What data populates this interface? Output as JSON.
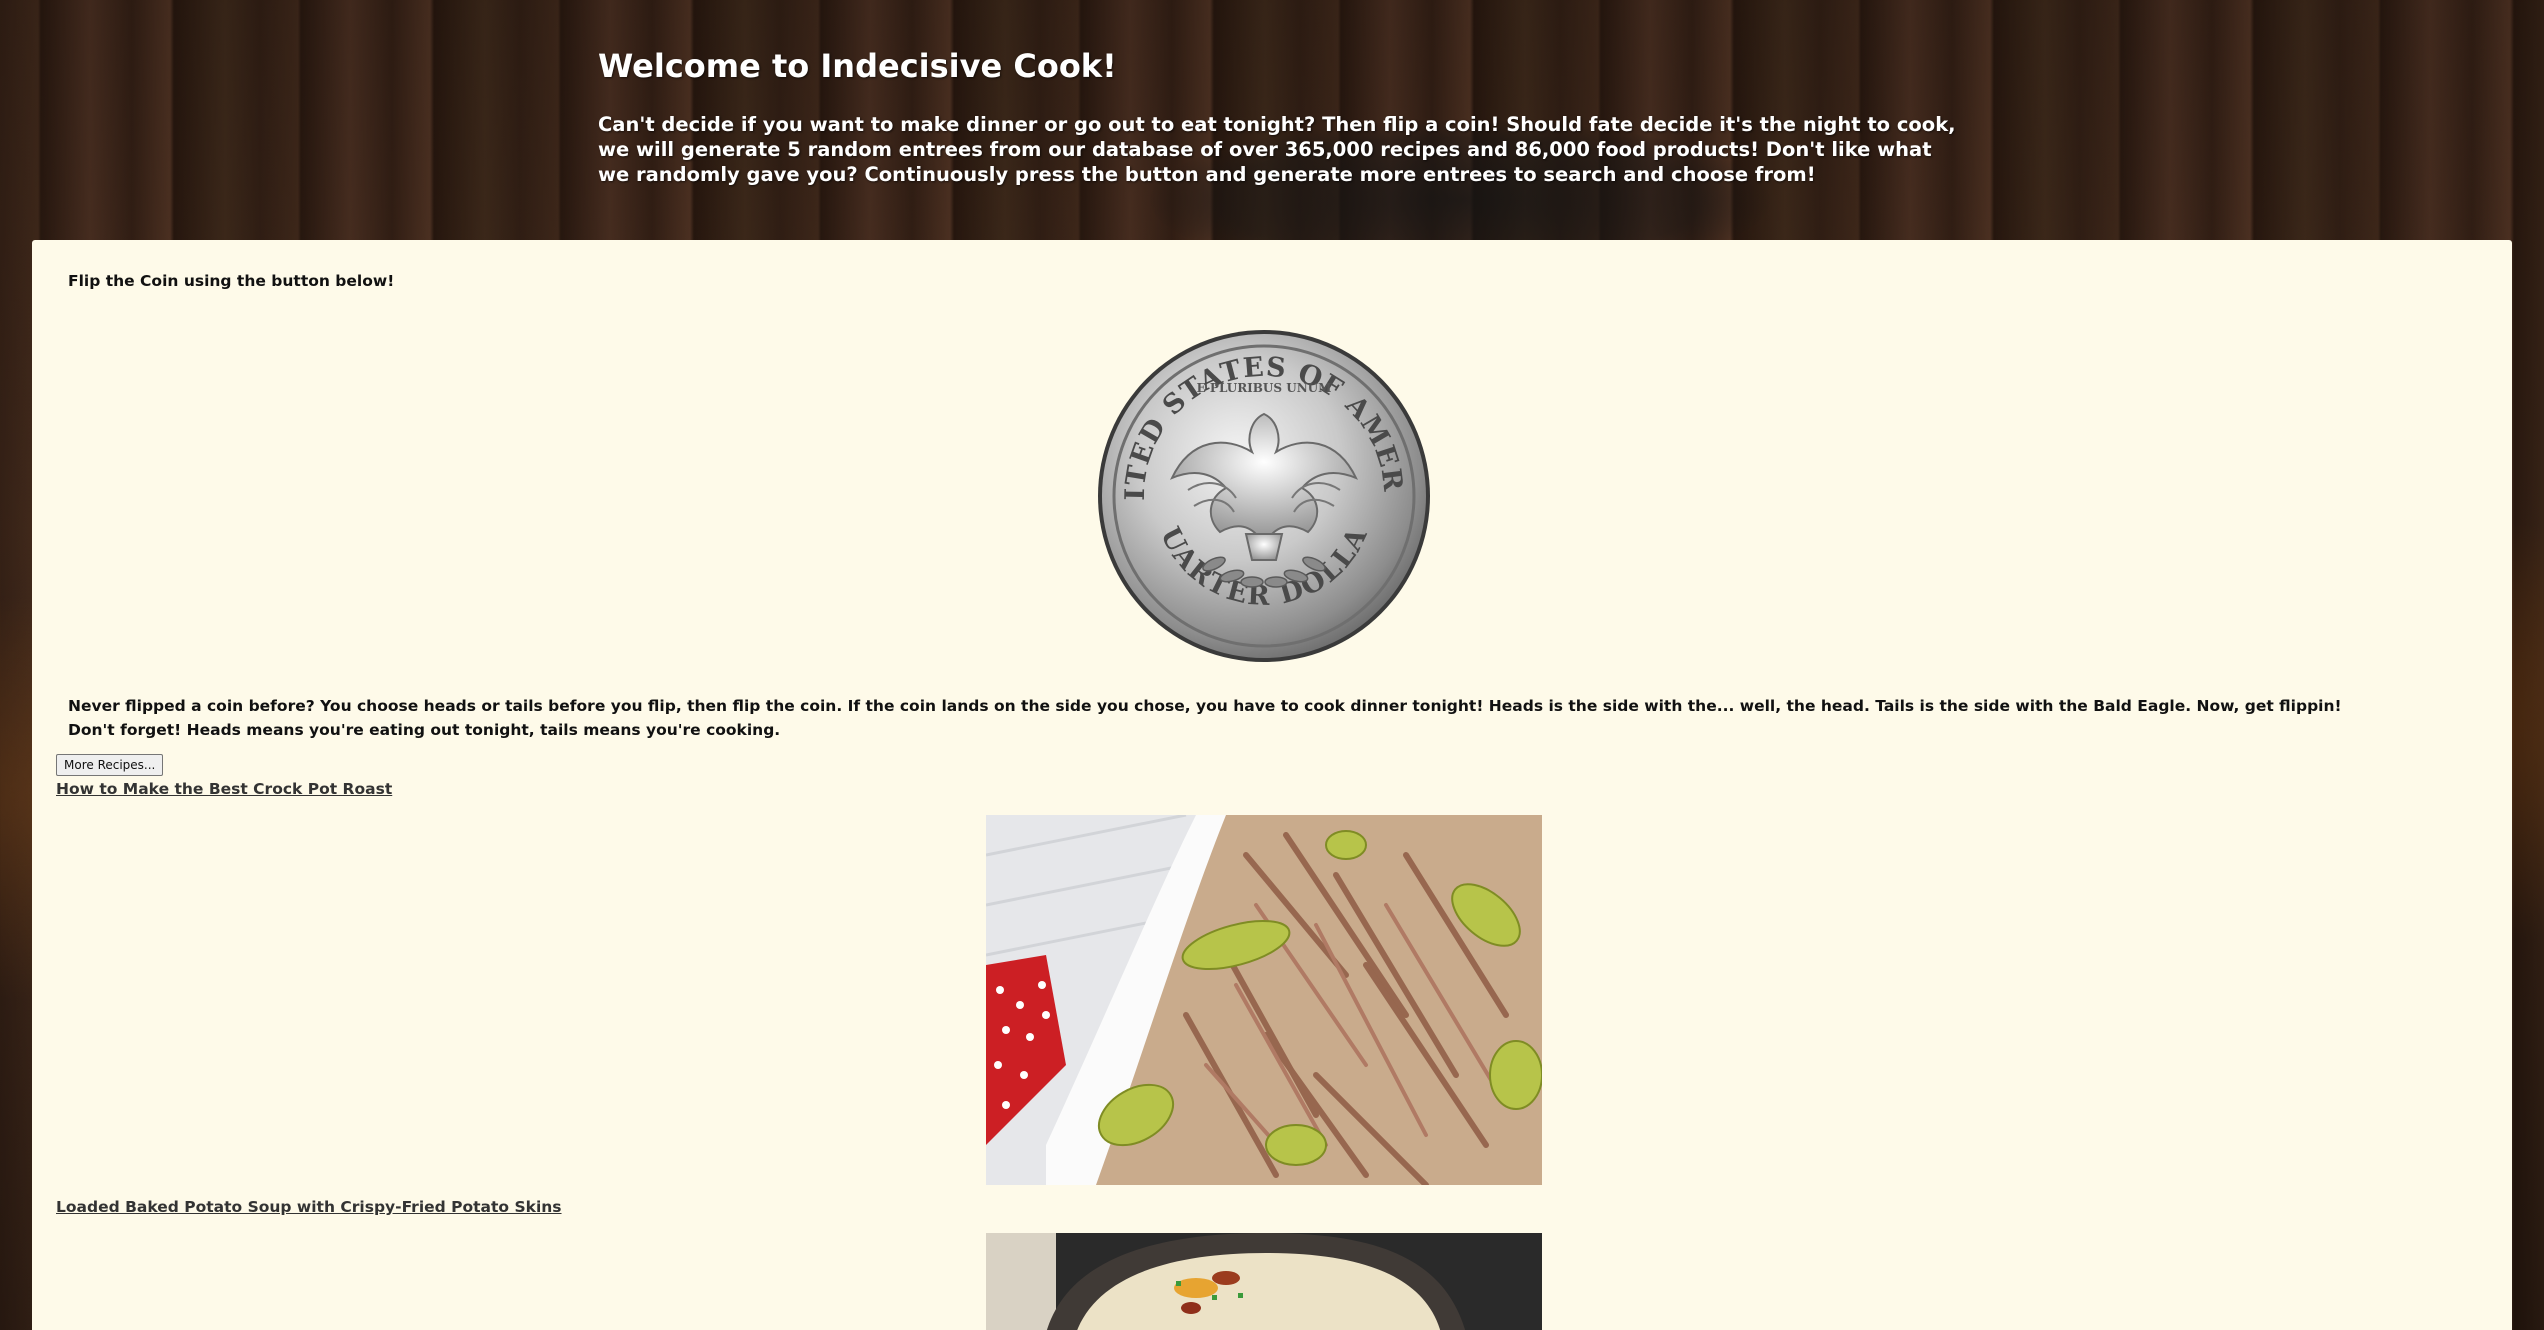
{
  "header": {
    "title": "Welcome to Indecisive Cook!",
    "intro": "Can't decide if you want to make dinner or go out to eat tonight? Then flip a coin! Should fate decide it's the night to cook, we will generate 5 random entrees from our database of over 365,000 recipes and 86,000 food products! Don't like what we randomly gave you? Continuously press the button and generate more entrees to search and choose from!"
  },
  "coin_section": {
    "instruction": "Flip the Coin using the button below!",
    "coin_top_text": "UNITED STATES OF AMERICA",
    "coin_motto": "E PLURIBUS UNUM",
    "coin_bottom_text": "QUARTER DOLLAR",
    "help_text": "Never flipped a coin before? You choose heads or tails before you flip, then flip the coin. If the coin lands on the side you chose, you have to cook dinner tonight! Heads is the side with the... well, the head. Tails is the side with the Bald Eagle. Now, get flippin! Don't forget! Heads means you're eating out tonight, tails means you're cooking."
  },
  "recipes": {
    "more_button_label": "More Recipes...",
    "items": [
      {
        "title": "How to Make the Best Crock Pot Roast",
        "image": "shredded-pot-roast-photo"
      },
      {
        "title": "Loaded Baked Potato Soup with Crispy-Fried Potato Skins",
        "image": "potato-soup-photo"
      }
    ]
  },
  "colors": {
    "panel_background": "#fefae9",
    "header_text": "#ffffff",
    "link_text": "#333333"
  }
}
